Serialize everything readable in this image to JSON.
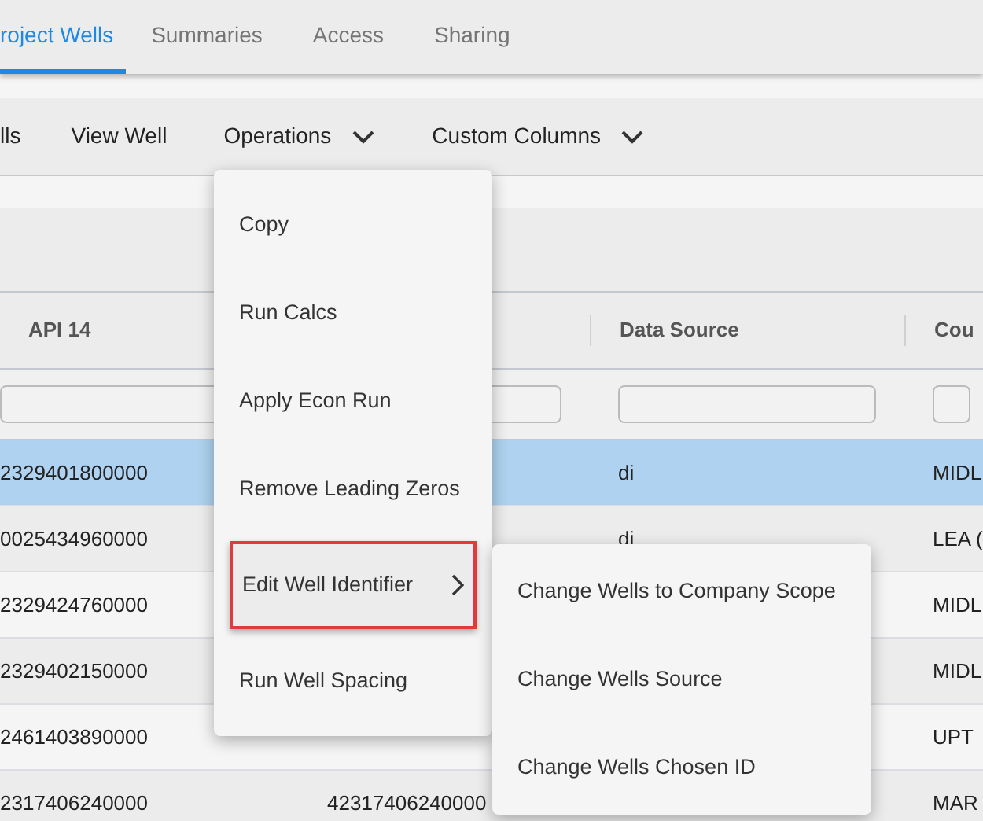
{
  "tabs": [
    {
      "label": "roject Wells",
      "selected": true
    },
    {
      "label": "Summaries",
      "selected": false
    },
    {
      "label": "Access",
      "selected": false
    },
    {
      "label": "Sharing",
      "selected": false
    }
  ],
  "toolbar": [
    {
      "label": "lls",
      "caret": false
    },
    {
      "label": "View Well",
      "caret": false
    },
    {
      "label": "Operations",
      "caret": true
    },
    {
      "label": "Custom Columns",
      "caret": true
    }
  ],
  "table": {
    "columns": [
      {
        "kind": "text",
        "label": "API 14"
      },
      {
        "kind": "blank"
      },
      {
        "kind": "text",
        "label": "Data Source"
      },
      {
        "kind": "text",
        "label": "Cou"
      }
    ],
    "rows": [
      {
        "selected": true,
        "cells": [
          "2329401800000",
          null,
          "di",
          "MIDL"
        ]
      },
      {
        "selected": false,
        "cells": [
          "0025434960000",
          null,
          "di",
          "LEA ("
        ]
      },
      {
        "selected": false,
        "cells": [
          "2329424760000",
          null,
          null,
          "MIDL"
        ]
      },
      {
        "selected": false,
        "cells": [
          "2329402150000",
          null,
          null,
          "MIDL"
        ]
      },
      {
        "selected": false,
        "cells": [
          "2461403890000",
          null,
          null,
          "UPT"
        ]
      },
      {
        "selected": false,
        "cells": [
          "2317406240000",
          "42317406240000",
          null,
          "MAR"
        ]
      }
    ]
  },
  "menu": {
    "items": [
      {
        "label": "Copy",
        "submenu": false,
        "highlighted": false
      },
      {
        "label": "Run Calcs",
        "submenu": false,
        "highlighted": false
      },
      {
        "label": "Apply Econ Run",
        "submenu": false,
        "highlighted": false
      },
      {
        "label": "Remove Leading Zeros",
        "submenu": false,
        "highlighted": false
      },
      {
        "label": "Edit Well Identifier",
        "submenu": true,
        "highlighted": true
      },
      {
        "label": "Run Well Spacing",
        "submenu": false,
        "highlighted": false
      }
    ]
  },
  "submenu": {
    "items": [
      {
        "label": "Change Wells to Company Scope"
      },
      {
        "label": "Change Wells Source"
      },
      {
        "label": "Change Wells Chosen ID"
      }
    ]
  }
}
